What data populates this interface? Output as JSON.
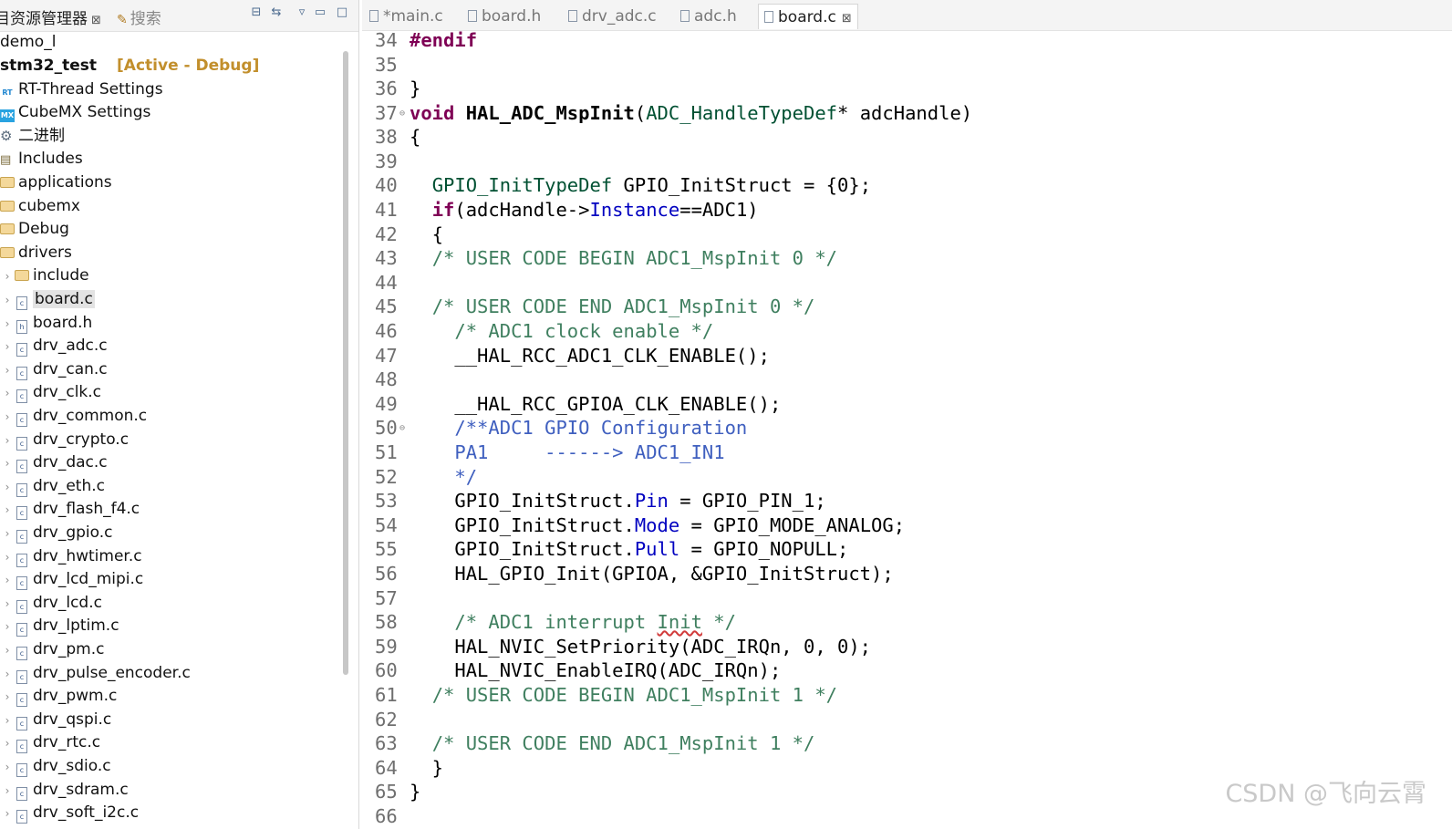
{
  "explorer": {
    "tab_label": "目资源管理器",
    "search_label": "搜索",
    "items": [
      {
        "label": "demo_l"
      },
      {
        "label": "stm32_test",
        "tag": "[Active - Debug]"
      },
      {
        "label": "RT-Thread Settings"
      },
      {
        "label": "CubeMX Settings"
      },
      {
        "label": "二进制"
      },
      {
        "label": "Includes"
      },
      {
        "label": "applications"
      },
      {
        "label": "cubemx"
      },
      {
        "label": "Debug"
      },
      {
        "label": "drivers"
      },
      {
        "label": "include"
      },
      {
        "label": "board.c"
      },
      {
        "label": "board.h"
      },
      {
        "label": "drv_adc.c"
      },
      {
        "label": "drv_can.c"
      },
      {
        "label": "drv_clk.c"
      },
      {
        "label": "drv_common.c"
      },
      {
        "label": "drv_crypto.c"
      },
      {
        "label": "drv_dac.c"
      },
      {
        "label": "drv_eth.c"
      },
      {
        "label": "drv_flash_f4.c"
      },
      {
        "label": "drv_gpio.c"
      },
      {
        "label": "drv_hwtimer.c"
      },
      {
        "label": "drv_lcd_mipi.c"
      },
      {
        "label": "drv_lcd.c"
      },
      {
        "label": "drv_lptim.c"
      },
      {
        "label": "drv_pm.c"
      },
      {
        "label": "drv_pulse_encoder.c"
      },
      {
        "label": "drv_pwm.c"
      },
      {
        "label": "drv_qspi.c"
      },
      {
        "label": "drv_rtc.c"
      },
      {
        "label": "drv_sdio.c"
      },
      {
        "label": "drv_sdram.c"
      },
      {
        "label": "drv_soft_i2c.c"
      }
    ]
  },
  "editor": {
    "tabs": [
      {
        "label": "*main.c"
      },
      {
        "label": "board.h"
      },
      {
        "label": "drv_adc.c"
      },
      {
        "label": "adc.h"
      },
      {
        "label": "board.c"
      }
    ],
    "line_numbers": [
      "34",
      "35",
      "36",
      "37",
      "38",
      "39",
      "40",
      "41",
      "42",
      "43",
      "44",
      "45",
      "46",
      "47",
      "48",
      "49",
      "50",
      "51",
      "52",
      "53",
      "54",
      "55",
      "56",
      "57",
      "58",
      "59",
      "60",
      "61",
      "62",
      "63",
      "64",
      "65",
      "66"
    ]
  },
  "watermark": "CSDN @飞向云霄"
}
